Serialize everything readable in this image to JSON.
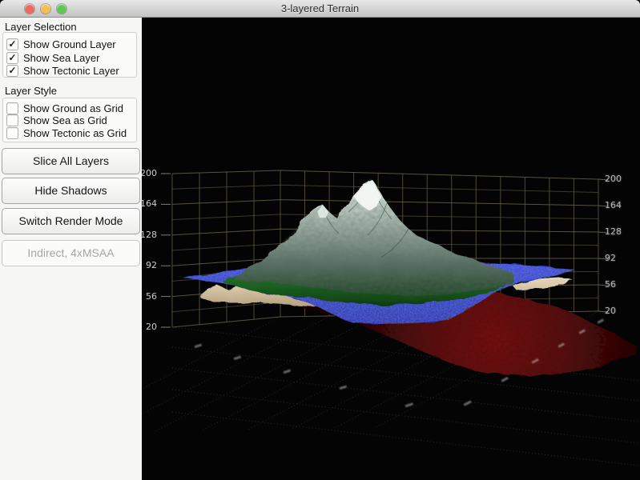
{
  "window": {
    "title": "3-layered Terrain",
    "traffic_lights": [
      "#ed6a5f",
      "#f5bf4f",
      "#61c654"
    ]
  },
  "sidebar": {
    "layer_selection": {
      "label": "Layer Selection",
      "items": [
        {
          "label": "Show Ground Layer",
          "checked": true,
          "mark": "✓"
        },
        {
          "label": "Show Sea Layer",
          "checked": true,
          "mark": "✓"
        },
        {
          "label": "Show Tectonic Layer",
          "checked": true,
          "mark": "✓"
        }
      ]
    },
    "layer_style": {
      "label": "Layer Style",
      "items": [
        {
          "label": "Show Ground as Grid",
          "checked": false,
          "mark": ""
        },
        {
          "label": "Show Sea as Grid",
          "checked": false,
          "mark": ""
        },
        {
          "label": "Show Tectonic as Grid",
          "checked": false,
          "mark": ""
        }
      ]
    },
    "buttons": [
      {
        "label": "Slice All Layers"
      },
      {
        "label": "Hide Shadows"
      },
      {
        "label": "Switch Render Mode"
      }
    ],
    "status": {
      "label": "Indirect, 4xMSAA"
    }
  },
  "scene": {
    "y_axis_left": [
      "200",
      "164",
      "128",
      "92",
      "56",
      "20"
    ],
    "y_axis_right": [
      "200",
      "164",
      "128",
      "92",
      "56",
      "20"
    ],
    "colors": {
      "snow": "#f4f8f4",
      "ground_green": "#2e8c36",
      "sea_blue": "#2836c8",
      "tectonic_red": "#8c1616",
      "sand": "#cfb896",
      "grid_line": "#6b654c"
    }
  }
}
